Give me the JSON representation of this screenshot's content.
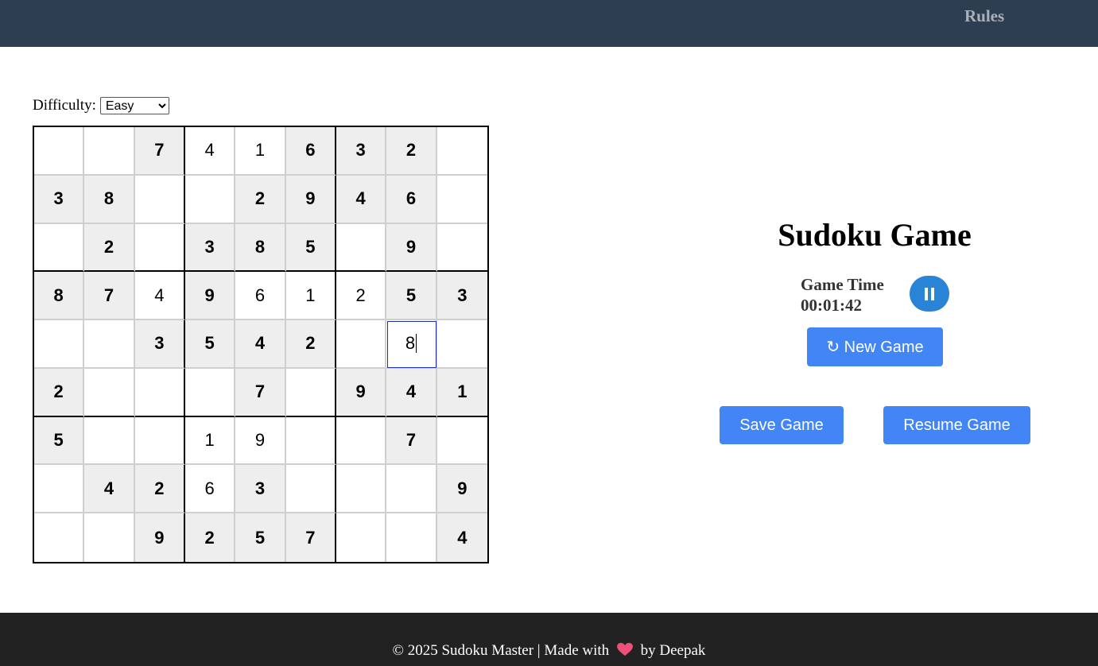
{
  "header": {
    "rules_link": "Rules"
  },
  "difficulty": {
    "label": "Difficulty:",
    "selected": "Easy",
    "options": [
      "Easy"
    ]
  },
  "board": {
    "grid": [
      [
        "",
        "",
        "7",
        "4",
        "1",
        "6",
        "3",
        "2",
        ""
      ],
      [
        "3",
        "8",
        "",
        "",
        "2",
        "9",
        "4",
        "6",
        ""
      ],
      [
        "",
        "2",
        "",
        "3",
        "8",
        "5",
        "",
        "9",
        ""
      ],
      [
        "8",
        "7",
        "4",
        "9",
        "6",
        "1",
        "2",
        "5",
        "3"
      ],
      [
        "",
        "",
        "3",
        "5",
        "4",
        "2",
        "",
        "8",
        ""
      ],
      [
        "2",
        "",
        "",
        "",
        "7",
        "",
        "9",
        "4",
        "1"
      ],
      [
        "5",
        "",
        "",
        "1",
        "9",
        "",
        "",
        "7",
        ""
      ],
      [
        "",
        "4",
        "2",
        "6",
        "3",
        "",
        "",
        "",
        "9"
      ],
      [
        "",
        "",
        "9",
        "2",
        "5",
        "7",
        "",
        "",
        "4"
      ]
    ],
    "given": [
      [
        0,
        0,
        1,
        0,
        0,
        1,
        1,
        1,
        0
      ],
      [
        1,
        1,
        0,
        0,
        1,
        1,
        1,
        1,
        0
      ],
      [
        0,
        1,
        0,
        1,
        1,
        1,
        0,
        1,
        0
      ],
      [
        1,
        1,
        0,
        1,
        0,
        0,
        0,
        1,
        1
      ],
      [
        0,
        0,
        1,
        1,
        1,
        1,
        0,
        0,
        0
      ],
      [
        1,
        0,
        0,
        0,
        1,
        0,
        1,
        1,
        1
      ],
      [
        1,
        0,
        0,
        0,
        0,
        0,
        0,
        1,
        0
      ],
      [
        0,
        1,
        1,
        0,
        1,
        0,
        0,
        0,
        1
      ],
      [
        0,
        0,
        1,
        1,
        1,
        1,
        0,
        0,
        1
      ]
    ],
    "selected_cell": [
      4,
      7
    ]
  },
  "game": {
    "title": "Sudoku Game",
    "timer_label": "Game Time",
    "timer_value": "00:01:42",
    "pause_icon": "pause-icon",
    "new_game_label": "↻ New Game",
    "save_label": "Save Game",
    "resume_label": "Resume Game"
  },
  "footer": {
    "prefix": "© 2025 Sudoku Master | Made with",
    "heart_icon": "heart-icon",
    "suffix": "by Deepak"
  },
  "colors": {
    "topbar": "#2e3e51",
    "button": "#4285f4",
    "pause_button": "#2a84d6",
    "given_cell": "#eeeeee",
    "footer": "#222222",
    "heart": "#ef4f7a"
  }
}
